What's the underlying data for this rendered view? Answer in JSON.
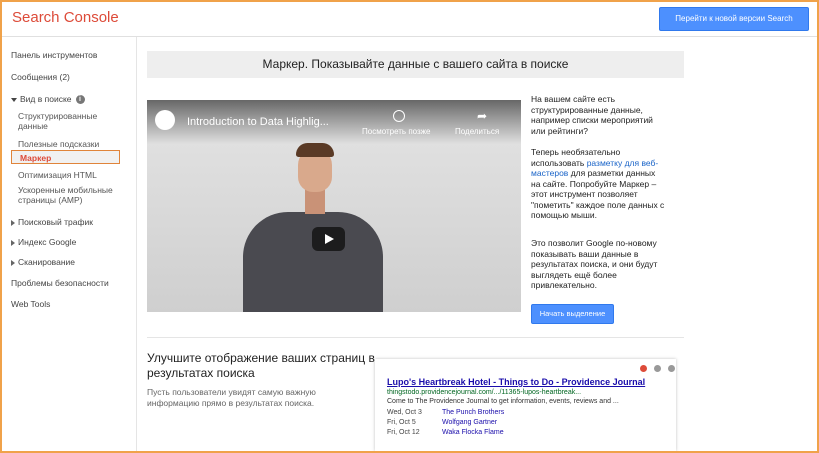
{
  "header": {
    "brand": "Search Console",
    "new_version_button": "Перейти к новой версии Search Console"
  },
  "sidebar": {
    "dashboard": "Панель инструментов",
    "messages": "Сообщения (2)",
    "search_appearance": "Вид в поиске",
    "structured_data": [
      "Структурированные",
      "данные"
    ],
    "rich_cards": "Полезные подсказки",
    "data_highlighter": "Маркер",
    "html_improvements": "Оптимизация HTML",
    "amp": [
      "Ускоренные мобильные",
      "страницы (AMP)"
    ],
    "search_traffic": "Поисковый трафик",
    "google_index": "Индекс Google",
    "crawl": "Сканирование",
    "security_issues": "Проблемы безопасности",
    "web_tools": "Web Tools"
  },
  "main": {
    "heading": "Маркер. Показывайте данные с вашего сайта в поиске",
    "video": {
      "title": "Introduction to Data Highlig...",
      "watch_later": "Посмотреть позже",
      "share": "Поделиться"
    },
    "intro_lines": [
      "На вашем сайте есть",
      "структурированные данные,",
      "например списки мероприятий",
      "или рейтинги?"
    ],
    "para2_lines": [
      "Теперь необязательно",
      "использовать "
    ],
    "para2_link_lines": [
      "разметку для веб-",
      "мастеров"
    ],
    "para2_rest_lines": [
      " для разметки данных",
      "на сайте. Попробуйте Маркер –",
      "этот инструмент позволяет",
      "\"пометить\" каждое поле данных с",
      "помощью мыши."
    ],
    "para3_lines": [
      "Это позволит Google по-новому",
      "показывать ваши данные в",
      "результатах поиска, и они будут",
      "выглядеть ещё более",
      "привлекательно."
    ],
    "start_button": "Начать выделение",
    "subheading": "Улучшите отображение ваших страниц в результатах поиска",
    "subdesc": "Пусть пользователи увидят самую важную информацию прямо в результатах поиска."
  },
  "serp": {
    "title": "Lupo's Heartbreak Hotel - Things to Do - Providence Journal",
    "url": "thingstodo.providencejournal.com/.../11365-lupos-heartbreak...",
    "snippet": "Come to The Providence Journal to get information, events, reviews and ...",
    "rows": [
      {
        "date": "Wed, Oct 3",
        "name": "The Punch Brothers"
      },
      {
        "date": "Fri, Oct 5",
        "name": "Wolfgang Gartner"
      },
      {
        "date": "Fri, Oct 12",
        "name": "Waka Flocka Flame"
      }
    ],
    "dot_colors": [
      "#dd4b39",
      "#999999",
      "#999999"
    ]
  }
}
